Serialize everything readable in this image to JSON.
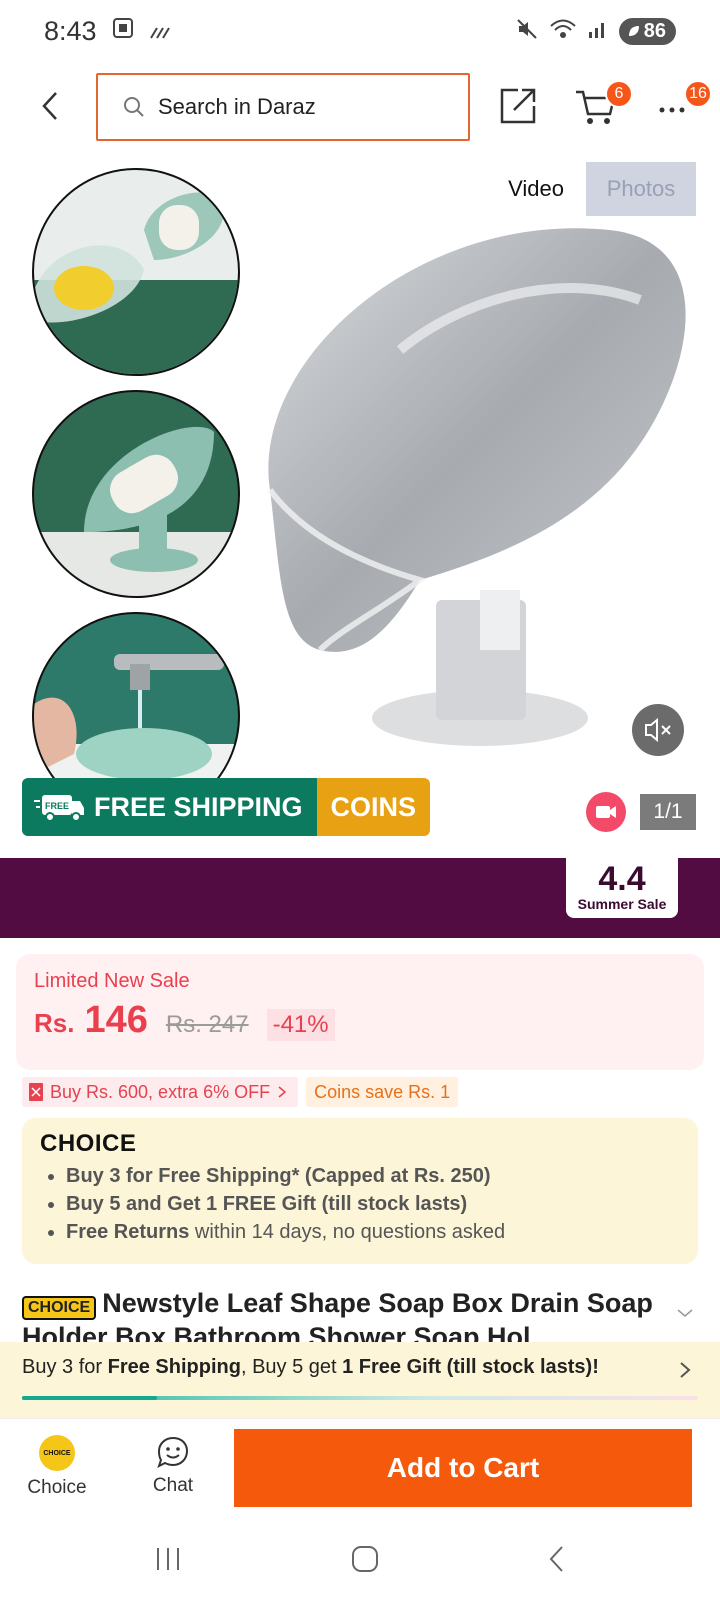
{
  "status": {
    "time": "8:43",
    "battery": "86",
    "icons": [
      "screenshot-icon",
      "signal-dots-icon",
      "mute-icon",
      "wifi-icon",
      "cell-signal-icon"
    ]
  },
  "header": {
    "search_placeholder": "Search in Daraz",
    "cart_count": "6",
    "more_count": "16"
  },
  "media": {
    "tab_video": "Video",
    "tab_photos": "Photos",
    "shipping_label": "FREE SHIPPING",
    "shipping_truck_tag": "FREE",
    "coins_label": "COINS",
    "page_indicator": "1/1"
  },
  "sale_banner": {
    "number": "4.4",
    "text": "Summer Sale",
    "color": "#520c42"
  },
  "price": {
    "label": "Limited New Sale",
    "currency": "Rs.",
    "current": "146",
    "original": "Rs. 247",
    "discount": "-41%",
    "color": "#e8404f"
  },
  "promos": {
    "voucher": "Buy Rs. 600, extra 6% OFF",
    "coins": "Coins save Rs. 1"
  },
  "choice": {
    "logo": "CHOICE",
    "items": [
      {
        "bold": "Buy 3 for  Free Shipping* (Capped at Rs. 250)",
        "rest": ""
      },
      {
        "bold": "Buy 5 and Get 1 FREE Gift (till stock lasts)",
        "rest": ""
      },
      {
        "bold": "Free Returns",
        "rest": " within 14 days, no questions asked"
      }
    ]
  },
  "product": {
    "badge": "CHOICE",
    "title": "Newstyle Leaf Shape Soap Box Drain Soap Holder Box Bathroom Shower Soap Hol"
  },
  "promo_strip": {
    "part1": "Buy 3 for ",
    "bold1": "Free Shipping",
    "part2": ", Buy 5 get ",
    "bold2": "1 Free Gift (till stock lasts)!",
    "progress": 0.2
  },
  "bottom": {
    "choice_label": "Choice",
    "choice_mark": "CHOICE",
    "chat_label": "Chat",
    "add_to_cart": "Add to Cart",
    "accent": "#f5590b"
  }
}
